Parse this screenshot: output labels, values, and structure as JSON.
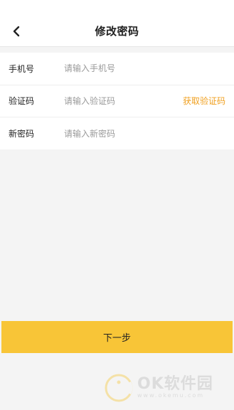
{
  "header": {
    "title": "修改密码",
    "back_icon": "chevron-left-icon"
  },
  "form": {
    "phone": {
      "label": "手机号",
      "placeholder": "请输入手机号",
      "value": ""
    },
    "code": {
      "label": "验证码",
      "placeholder": "请输入验证码",
      "value": "",
      "action_label": "获取验证码"
    },
    "password": {
      "label": "新密码",
      "placeholder": "请输入新密码",
      "value": ""
    }
  },
  "actions": {
    "next_label": "下一步"
  },
  "watermark": {
    "brand": "OK软件园",
    "url": "www.okemu.com"
  },
  "colors": {
    "accent": "#f8c537",
    "link": "#f0a020",
    "background": "#f4f4f4"
  }
}
